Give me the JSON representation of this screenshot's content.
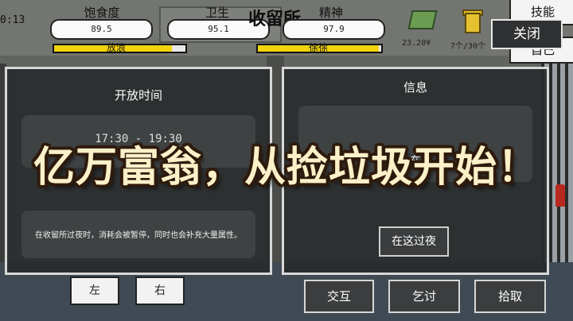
{
  "hud": {
    "clock": "0:13",
    "title": "收留所",
    "stats": [
      {
        "label": "饱食度",
        "value": "89.5",
        "fill": 0.895
      },
      {
        "label": "卫生",
        "value": "95.1",
        "fill": 0.951
      },
      {
        "label": "精神",
        "value": "97.9",
        "fill": 0.979
      }
    ],
    "bar_status_left": "放浪",
    "bar_status_right": "徐徐",
    "money": "23.20¥",
    "trash_capacity": "7个/30个",
    "skills_label": "技能",
    "self_label": "自己",
    "close_label": "关闭"
  },
  "left_panel": {
    "title": "开放时间",
    "hours": "17:30 - 19:30",
    "description": "在收留所过夜时，消耗会被暂停，同时也会补充大量属性。"
  },
  "right_panel": {
    "title": "信息",
    "info_text": "在",
    "stay_button": "在这过夜"
  },
  "bottom_bar": {
    "left_button": "左",
    "right_button": "右",
    "interact": "交互",
    "beg": "乞讨",
    "pickup": "拾取"
  },
  "banner_text": "亿万富翁，从捡垃圾开始！"
}
